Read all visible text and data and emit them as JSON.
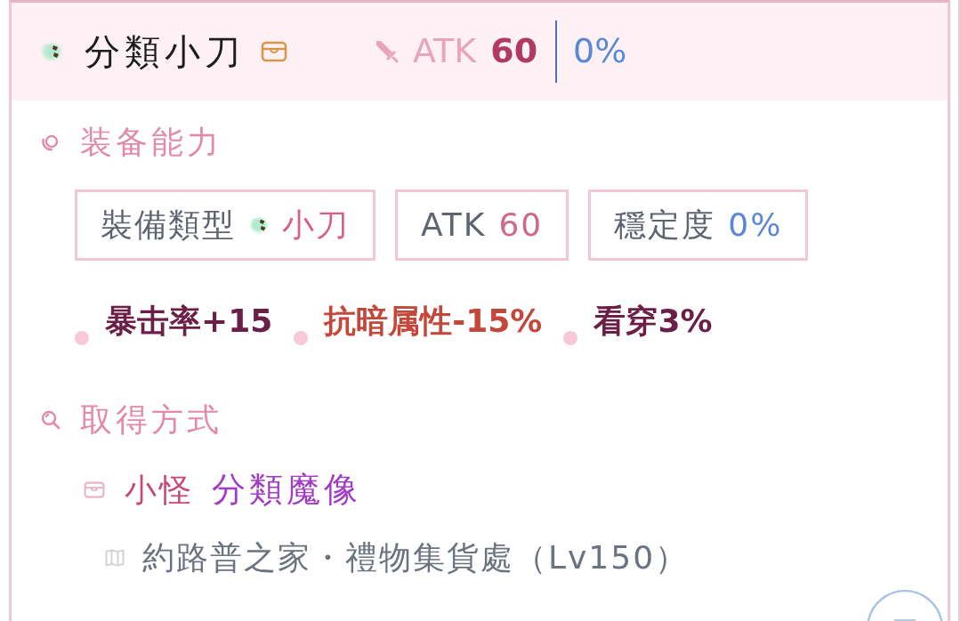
{
  "item": {
    "name": "分類小刀",
    "attack": {
      "label": "ATK",
      "value": "60"
    },
    "stability": "0%"
  },
  "abilities": {
    "title": "装备能力",
    "stats": [
      {
        "kind": "type",
        "label": "裝備類型",
        "value": "小刀"
      },
      {
        "kind": "attack",
        "label": "ATK",
        "value": "60"
      },
      {
        "kind": "stability",
        "label": "穩定度",
        "value": "0%"
      }
    ],
    "bonuses": [
      {
        "text": "暴击率+15",
        "color": "#6b1e46"
      },
      {
        "text": "抗暗属性-15%",
        "color": "#c4473b"
      },
      {
        "text": "看穿3%",
        "color": "#6b1e46"
      }
    ]
  },
  "obtain": {
    "title": "取得方式",
    "sources": [
      {
        "type": "小怪",
        "name": "分類魔像",
        "locations": [
          "約路普之家・禮物集貨處（Lv150）"
        ]
      }
    ]
  }
}
